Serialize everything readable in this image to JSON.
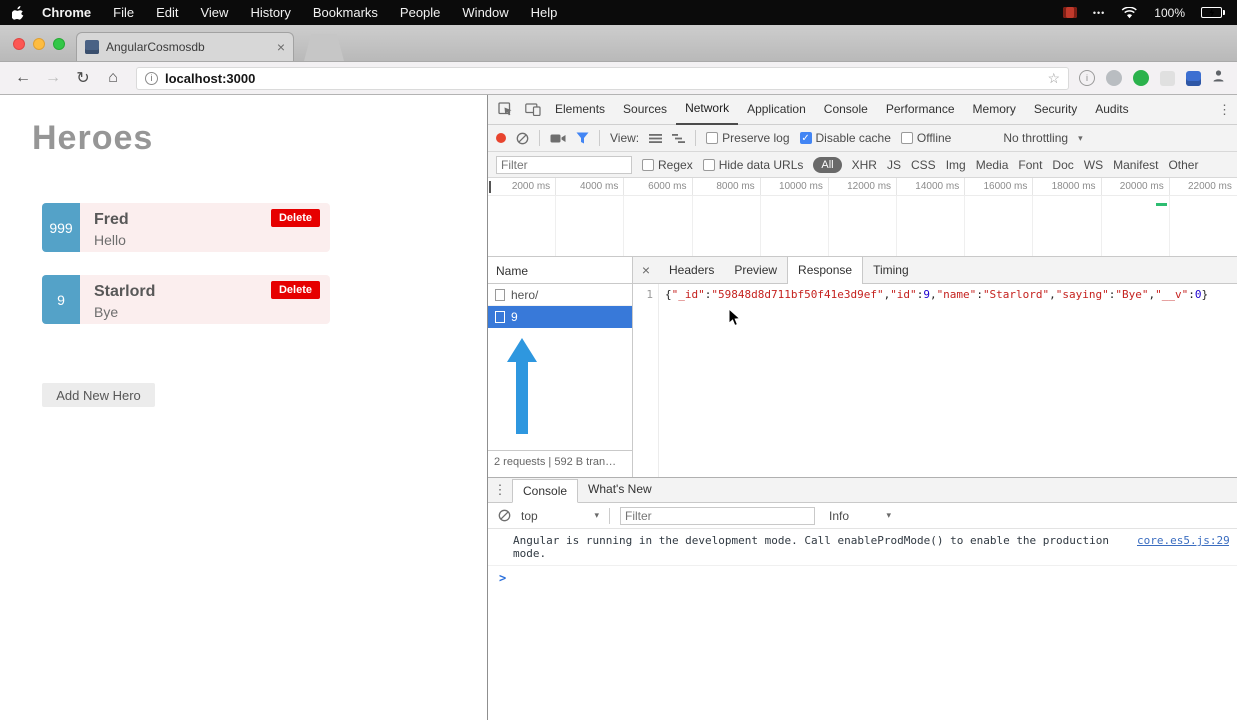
{
  "icons": {
    "back": "←",
    "forward": "→",
    "reload": "↻",
    "home": "⌂",
    "star": "☆",
    "close": "×",
    "check": "✓",
    "dropdown": "▾",
    "kebab": "⋮",
    "info": "i",
    "prompt": ">",
    "menu_dots": "•••"
  },
  "menubar": {
    "app": "Chrome",
    "items": [
      "File",
      "Edit",
      "View",
      "History",
      "Bookmarks",
      "People",
      "Window",
      "Help"
    ],
    "battery_pct": "100%"
  },
  "browser": {
    "tab_title": "AngularCosmosdb",
    "url": "localhost:3000"
  },
  "page": {
    "title": "Heroes",
    "add_button_label": "Add New Hero",
    "heroes": [
      {
        "badge": "999",
        "name": "Fred",
        "saying": "Hello",
        "delete_label": "Delete"
      },
      {
        "badge": "9",
        "name": "Starlord",
        "saying": "Bye",
        "delete_label": "Delete"
      }
    ]
  },
  "devtools": {
    "tabs": [
      "Elements",
      "Sources",
      "Network",
      "Application",
      "Console",
      "Performance",
      "Memory",
      "Security",
      "Audits"
    ],
    "network": {
      "view_label": "View:",
      "preserve_log_label": "Preserve log",
      "disable_cache_label": "Disable cache",
      "offline_label": "Offline",
      "throttling_value": "No throttling",
      "filter_placeholder": "Filter",
      "regex_label": "Regex",
      "hide_data_urls_label": "Hide data URLs",
      "types": [
        "All",
        "XHR",
        "JS",
        "CSS",
        "Img",
        "Media",
        "Font",
        "Doc",
        "WS",
        "Manifest",
        "Other"
      ],
      "ticks": [
        "2000 ms",
        "4000 ms",
        "6000 ms",
        "8000 ms",
        "10000 ms",
        "12000 ms",
        "14000 ms",
        "16000 ms",
        "18000 ms",
        "20000 ms",
        "22000 ms"
      ],
      "name_header": "Name",
      "requests": [
        {
          "name": "hero/"
        },
        {
          "name": "9"
        }
      ],
      "summary": "2 requests | 592 B tran…",
      "detail_tabs": [
        "Headers",
        "Preview",
        "Response",
        "Timing"
      ],
      "line_number": "1",
      "response_body": "{\"_id\":\"59848d8d711bf50f41e3d9ef\",\"id\":9,\"name\":\"Starlord\",\"saying\":\"Bye\",\"__v\":0}"
    },
    "console": {
      "tab_label": "Console",
      "whats_new_label": "What's New",
      "context_value": "top",
      "filter_placeholder": "Filter",
      "level_value": "Info",
      "message": "Angular is running in the development mode. Call enableProdMode() to enable the production mode.",
      "source_link": "core.es5.js:29"
    }
  }
}
